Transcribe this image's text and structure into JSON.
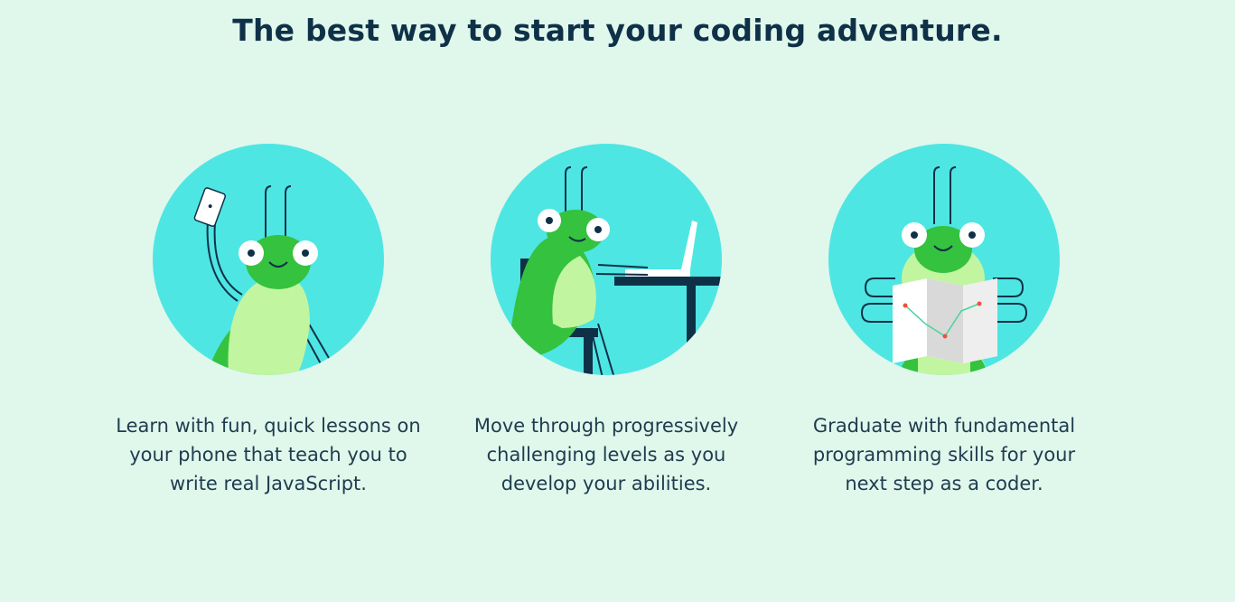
{
  "page": {
    "headline": "The best way to start your coding adventure."
  },
  "features": [
    {
      "lines": [
        "Learn with fun, quick lessons on",
        "your phone that teach you to",
        "write real JavaScript."
      ],
      "illustration": "grasshopper-holding-phone"
    },
    {
      "lines": [
        "Move through progressively",
        "challenging levels as you",
        "develop your abilities."
      ],
      "illustration": "grasshopper-at-laptop"
    },
    {
      "lines": [
        "Graduate with fundamental",
        "programming skills for your",
        "next step as a coder."
      ],
      "illustration": "grasshopper-reading-map"
    }
  ],
  "colors": {
    "background": "#e0f7ec",
    "circle": "#4ee6e3",
    "grasshopper_dark": "#35c23e",
    "grasshopper_light": "#c2f5a0",
    "navy": "#0f3148",
    "accent_red": "#f0503c"
  }
}
